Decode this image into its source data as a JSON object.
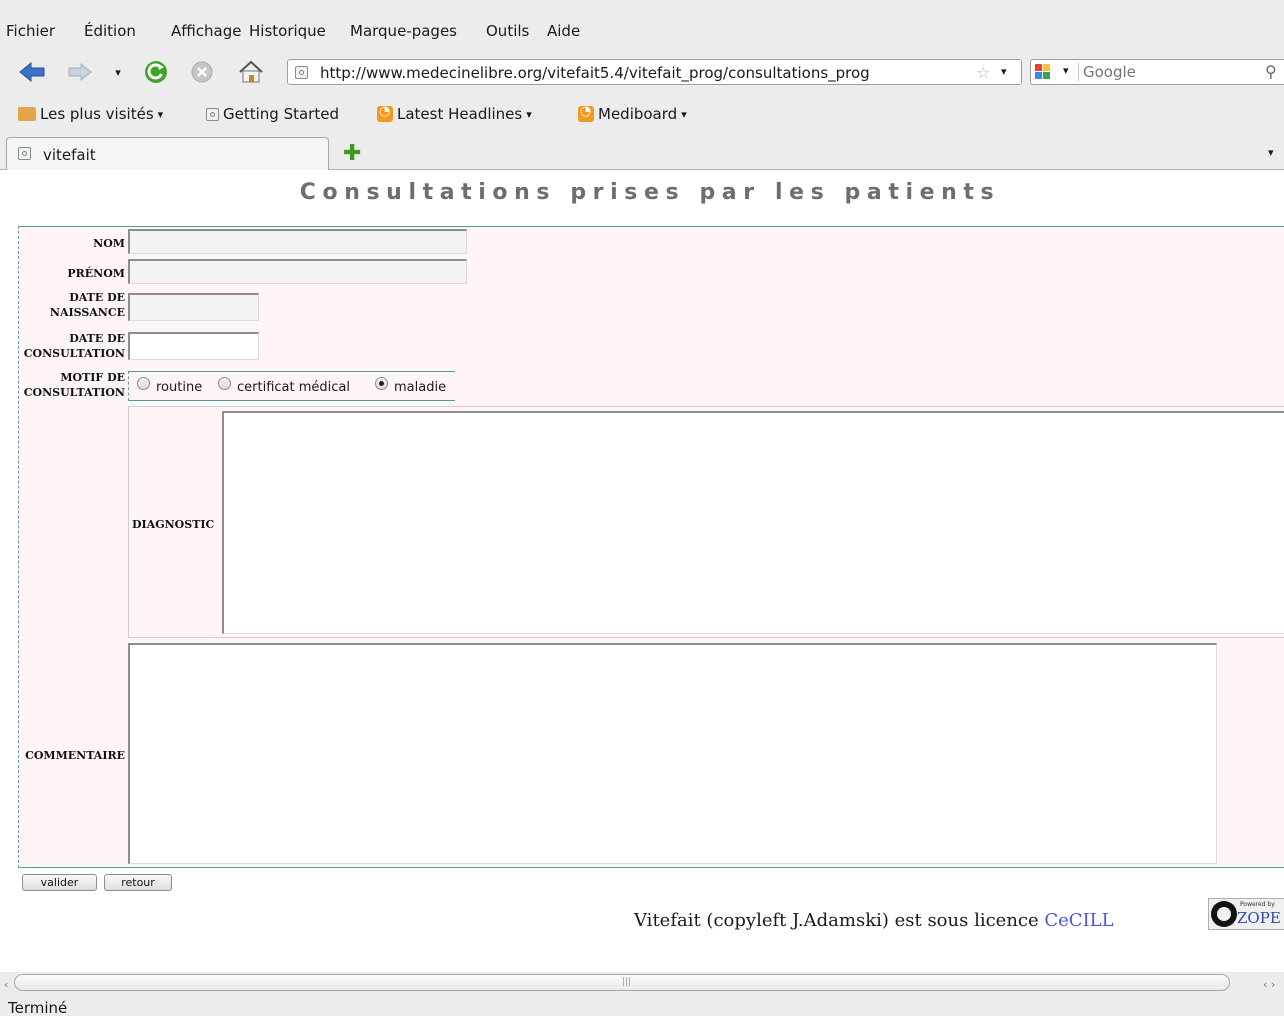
{
  "menu": {
    "file": "Fichier",
    "edit": "Édition",
    "view": "Affichage",
    "history": "Historique",
    "bookmarks": "Marque-pages",
    "tools": "Outils",
    "help": "Aide"
  },
  "navigation": {
    "url": "http://www.medecinelibre.org/vitefait5.4/vitefait_prog/consultations_prog",
    "search_placeholder": "Google"
  },
  "bookmarks_toolbar": {
    "most_visited": "Les plus visités",
    "getting_started": "Getting Started",
    "latest_headlines": "Latest Headlines",
    "mediboard": "Mediboard"
  },
  "tab": {
    "title": "vitefait"
  },
  "page": {
    "title": "Consultations prises par les patients"
  },
  "form": {
    "nom_label": "NOM",
    "prenom_label": "PRÉNOM",
    "naissance_label_1": "DATE DE",
    "naissance_label_2": "NAISSANCE",
    "consultation_label_1": "DATE DE",
    "consultation_label_2": "CONSULTATION",
    "motif_label_1": "MOTIF DE",
    "motif_label_2": "CONSULTATION",
    "motif_options": [
      "routine",
      "certificat médical",
      "maladie"
    ],
    "motif_selected": "maladie",
    "diagnostic_label": "DIAGNOSTIC",
    "commentaire_label": "COMMENTAIRE",
    "nom_value": "",
    "prenom_value": "",
    "naissance_value": "",
    "consultation_value": "",
    "diagnostic_value": "",
    "commentaire_value": ""
  },
  "buttons": {
    "valider": "valider",
    "retour": "retour"
  },
  "footer": {
    "text": "Vitefait (copyleft J.Adamski) est sous licence ",
    "link": "CeCILL",
    "badge_small": "Powered by",
    "badge_main": "ZOPE"
  },
  "status": {
    "text": "Terminé"
  },
  "colors": {
    "form_background": "#fff4f6",
    "form_border": "#4f9c9c",
    "link": "#4a57d9",
    "title_text": "#6e6e6e"
  }
}
